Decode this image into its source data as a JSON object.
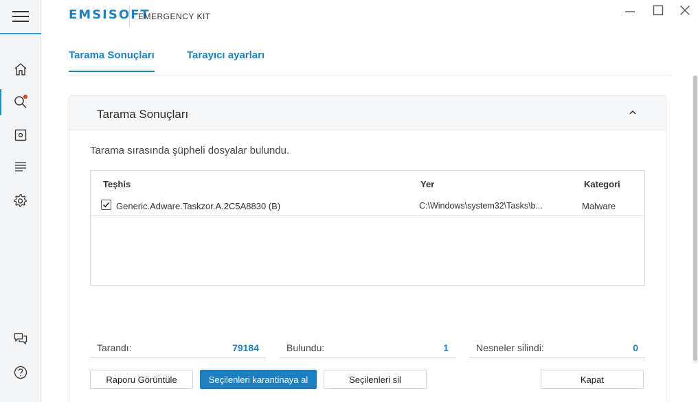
{
  "app": {
    "brand": "EMSISOFT",
    "product": "EMERGENCY KIT"
  },
  "colors": {
    "accent": "#1f82bf",
    "primary_button": "#1e7fc0",
    "notification": "#e2442e"
  },
  "sidebar": {
    "items": [
      {
        "icon": "home-icon"
      },
      {
        "icon": "search-icon",
        "active": true,
        "notification": true
      },
      {
        "icon": "quarantine-icon"
      },
      {
        "icon": "logs-icon"
      },
      {
        "icon": "settings-icon"
      },
      {
        "icon": "chat-icon"
      },
      {
        "icon": "help-icon"
      }
    ]
  },
  "tabs": [
    {
      "label": "Tarama Sonuçları",
      "active": true
    },
    {
      "label": "Tarayıcı ayarları",
      "active": false
    }
  ],
  "panel": {
    "title": "Tarama Sonuçları",
    "message": "Tarama sırasında şüpheli dosyalar bulundu."
  },
  "table": {
    "headers": {
      "detection": "Teşhis",
      "location": "Yer",
      "category": "Kategori"
    },
    "rows": [
      {
        "checked": true,
        "detection": "Generic.Adware.Taskzor.A.2C5A8830 (B)",
        "location": "C:\\Windows\\system32\\Tasks\\b...",
        "category": "Malware"
      }
    ]
  },
  "stats": {
    "scanned_label": "Tarandı:",
    "scanned_value": "79184",
    "found_label": "Bulundu:",
    "found_value": "1",
    "deleted_label": "Nesneler silindi:",
    "deleted_value": "0"
  },
  "buttons": {
    "view_report": "Raporu Görüntüle",
    "quarantine_selected": "Seçilenleri karantinaya al",
    "delete_selected": "Seçilenleri sil",
    "close": "Kapat"
  }
}
